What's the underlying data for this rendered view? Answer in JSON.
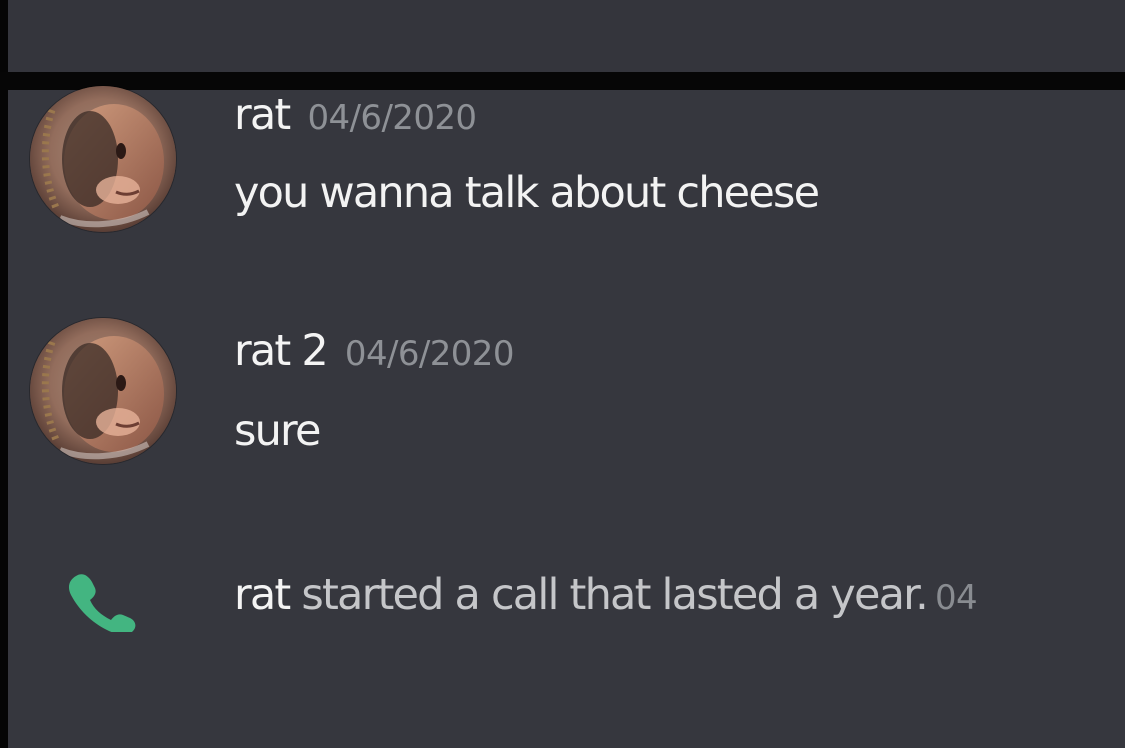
{
  "messages": [
    {
      "username": "rat",
      "timestamp": "04/6/2020",
      "text": "you wanna talk about cheese",
      "avatar_icon": "rat-avatar"
    },
    {
      "username": "rat 2",
      "timestamp": "04/6/2020",
      "text": "sure",
      "avatar_icon": "rat-avatar"
    }
  ],
  "call_event": {
    "username": "rat",
    "description": "started a call that lasted a year.",
    "timestamp_partial": "04",
    "icon": "phone-icon",
    "icon_color": "#43b581"
  },
  "colors": {
    "background": "#36373e",
    "text": "#f3f3f3",
    "muted": "#8e9196",
    "divider": "#060606"
  }
}
